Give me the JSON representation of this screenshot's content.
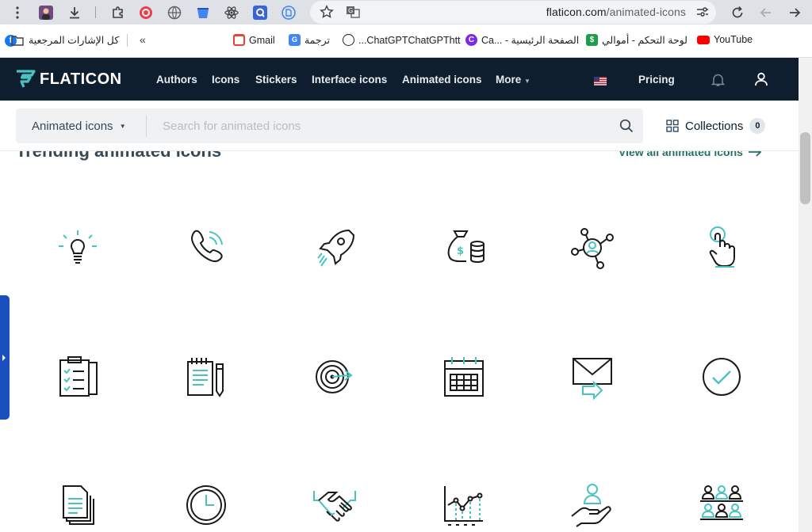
{
  "browser": {
    "url_host": "flaticon.com",
    "url_path": "/animated-icons"
  },
  "bookmarks": {
    "all_bookmarks": "كل الإشارات المرجعية",
    "items": [
      {
        "label": "YouTube"
      },
      {
        "label": "لوحة التحكم - أموالي"
      },
      {
        "label": "الصفحة الرئيسية - ...Ca"
      },
      {
        "label": "ChatGPTChatGPThtt..."
      },
      {
        "label": "ترجمة"
      },
      {
        "label": "Gmail"
      }
    ]
  },
  "header": {
    "logo": "FLATICON",
    "nav": [
      "Authors",
      "Icons",
      "Stickers",
      "Interface icons",
      "Animated icons"
    ],
    "more": "More",
    "pricing": "Pricing"
  },
  "search": {
    "category": "Animated icons",
    "placeholder": "Search for animated icons",
    "collections_label": "Collections",
    "collections_count": "0"
  },
  "content": {
    "title": "Trending animated icons",
    "view_all": "View all animated icons"
  },
  "icons": [
    "lightbulb-icon",
    "phone-icon",
    "rocket-icon",
    "money-bag-icon",
    "network-user-icon",
    "tap-hand-icon",
    "clipboard-icon",
    "notepad-pencil-icon",
    "target-icon",
    "calendar-icon",
    "mail-forward-icon",
    "check-circle-icon",
    "documents-icon",
    "clock-icon",
    "handshake-icon",
    "line-chart-icon",
    "hand-user-icon",
    "team-icon"
  ],
  "colors": {
    "header_bg": "#0e1e2f",
    "accent": "#4ac3c0",
    "link": "#247065"
  }
}
